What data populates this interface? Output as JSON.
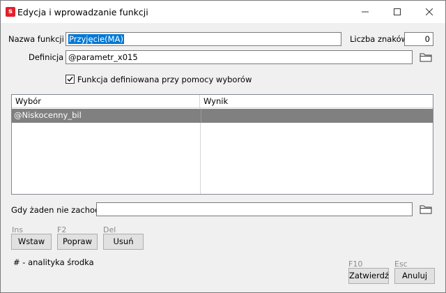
{
  "window": {
    "title": "Edycja i wprowadzanie funkcji",
    "app_icon_letter": "s",
    "accent_color": "#e3202a"
  },
  "form": {
    "name_label": "Nazwa funkcji",
    "name_value": "Przyjęcie(MA)",
    "char_count_label": "Liczba znaków",
    "char_count_value": "0",
    "definition_label": "Definicja",
    "definition_value": "@parametr_x015",
    "checkbox_label": "Funkcja definiowana przy pomocy wyborów",
    "checkbox_checked": true
  },
  "table": {
    "columns": [
      "Wybór",
      "Wynik"
    ],
    "rows": [
      {
        "wybor": "@Niskocenny_bil",
        "wynik": "",
        "selected": true
      }
    ]
  },
  "fallback": {
    "label": "Gdy żaden nie zachodzi:",
    "value": ""
  },
  "actions": {
    "insert_key": "Ins",
    "insert_label": "Wstaw",
    "edit_key": "F2",
    "edit_label": "Popraw",
    "delete_key": "Del",
    "delete_label": "Usuń"
  },
  "footer": {
    "note": "# - analityka środka",
    "confirm_key": "F10",
    "confirm_label": "Zatwierdź",
    "cancel_key": "Esc",
    "cancel_label": "Anuluj"
  },
  "icons": {
    "minimize": "minimize-icon",
    "maximize": "maximize-icon",
    "close": "close-icon",
    "folder": "folder-icon",
    "check": "checkmark-icon"
  }
}
